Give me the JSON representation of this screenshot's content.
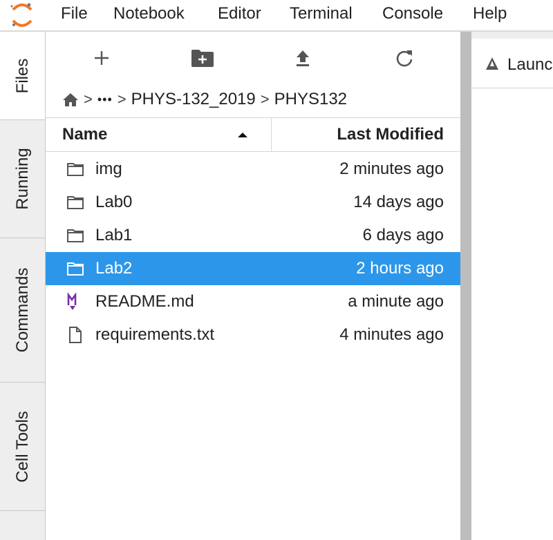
{
  "menubar": {
    "items": [
      "File",
      "Notebook",
      "Editor",
      "Terminal",
      "Console",
      "Help"
    ]
  },
  "sidetabs": [
    {
      "label": "Files",
      "active": true
    },
    {
      "label": "Running",
      "active": false
    },
    {
      "label": "Commands",
      "active": false
    },
    {
      "label": "Cell Tools",
      "active": false
    }
  ],
  "toolbar": {
    "icons": [
      "plus-icon",
      "new-folder-icon",
      "upload-icon",
      "refresh-icon"
    ]
  },
  "breadcrumbs": {
    "home_icon": "home-icon",
    "ellipsis": "•••",
    "separator": ">",
    "items": [
      "PHYS-132_2019",
      "PHYS132"
    ]
  },
  "listing": {
    "headers": {
      "name": "Name",
      "modified": "Last Modified"
    },
    "sort": "ascending",
    "files": [
      {
        "name": "img",
        "modified": "2 minutes ago",
        "icon": "folder-icon",
        "selected": false
      },
      {
        "name": "Lab0",
        "modified": "14 days ago",
        "icon": "folder-icon",
        "selected": false
      },
      {
        "name": "Lab1",
        "modified": "6 days ago",
        "icon": "folder-icon",
        "selected": false
      },
      {
        "name": "Lab2",
        "modified": "2 hours ago",
        "icon": "folder-icon",
        "selected": true
      },
      {
        "name": "README.md",
        "modified": "a minute ago",
        "icon": "markdown-icon",
        "selected": false
      },
      {
        "name": "requirements.txt",
        "modified": "4 minutes ago",
        "icon": "file-icon",
        "selected": false
      }
    ]
  },
  "main": {
    "tab_label": "Launc",
    "tab_icon": "launcher-icon"
  },
  "colors": {
    "selection": "#2c97ea",
    "logo_orange": "#f37726",
    "markdown_purple": "#7b2ca8"
  }
}
